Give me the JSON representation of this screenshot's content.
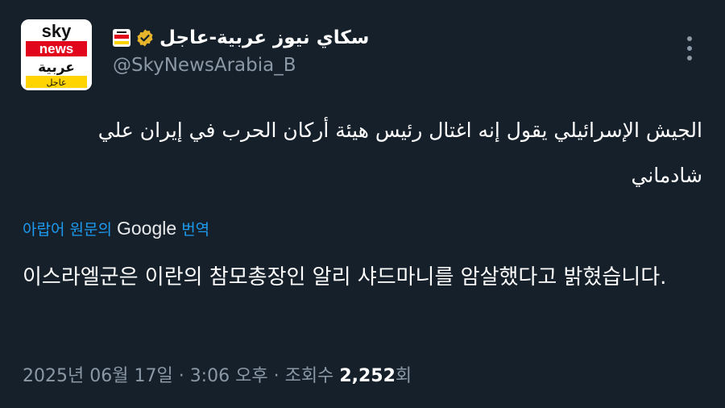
{
  "account": {
    "avatar_lines": [
      "sky",
      "news",
      "عربية",
      "عاجل"
    ],
    "display_name": "سكاي نيوز عربية-عاجل",
    "handle": "@SkyNewsArabia_B",
    "verified": true
  },
  "tweet": {
    "text_arabic": "الجيش الإسرائيلي يقول إنه اغتال رئيس هيئة أركان الحرب في إيران علي شادماني",
    "translation": {
      "prefix": "아랍어 원문의",
      "provider": "Google",
      "suffix": "번역"
    },
    "text_korean": "이스라엘군은 이란의 참모총장인 알리 샤드마니를 암살했다고 밝혔습니다."
  },
  "meta": {
    "date": "2025년 06월 17일",
    "separator": "·",
    "time": "3:06 오후",
    "views_label": "조회수",
    "views_count": "2,252",
    "views_unit": "회"
  },
  "colors": {
    "background": "#15202b",
    "accent": "#1d9bf0",
    "secondary_text": "#8b98a5",
    "brand_red": "#e1061b",
    "brand_yellow": "#ffd400",
    "verified_gold": "#e7b52c"
  },
  "icons": {
    "verified": "verified-badge-icon",
    "more": "more-options-icon"
  }
}
